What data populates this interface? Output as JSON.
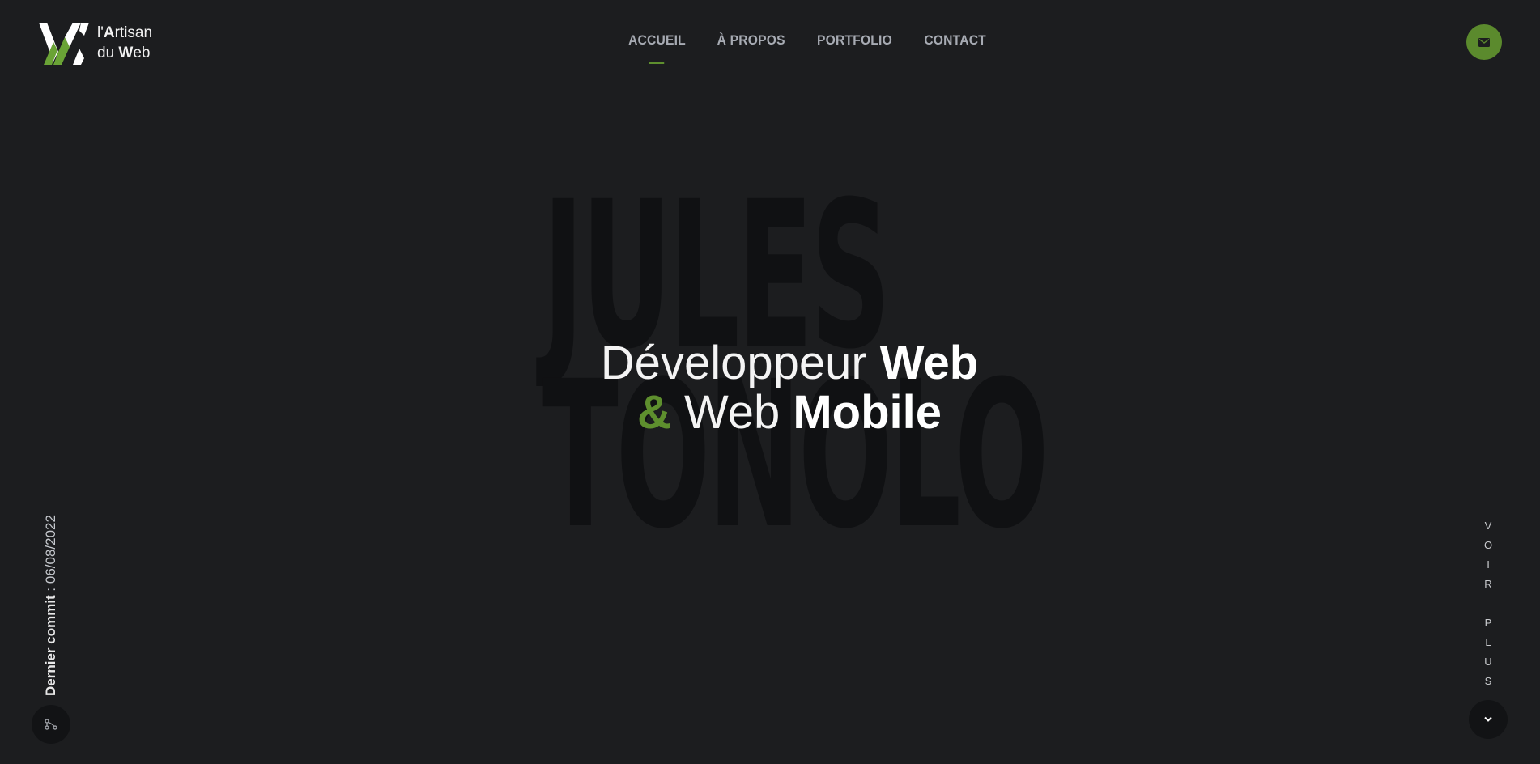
{
  "brand": {
    "line1_prefix": "l'",
    "line1_bold": "A",
    "line1_rest": "rtisan",
    "line2_prefix": "du ",
    "line2_bold": "W",
    "line2_rest": "eb",
    "logo_icon": "aw-logo-icon",
    "accent_color": "#5e8f2e"
  },
  "nav": {
    "items": [
      {
        "label": "ACCUEIL",
        "active": true
      },
      {
        "label": "À PROPOS",
        "active": false
      },
      {
        "label": "PORTFOLIO",
        "active": false
      },
      {
        "label": "CONTACT",
        "active": false
      }
    ]
  },
  "mail_button": {
    "icon": "envelope-icon"
  },
  "background_name": {
    "line1": "JULES",
    "line2": "TONOLO"
  },
  "hero": {
    "line1_light": "Développeur ",
    "line1_bold": "Web",
    "line2_amp": "&",
    "line2_light": " Web ",
    "line2_bold": "Mobile"
  },
  "commit": {
    "label": "Dernier commit",
    "separator": " : ",
    "date": "06/08/2022",
    "icon": "git-commit-icon"
  },
  "scroll": {
    "letters_1": [
      "V",
      "O",
      "I",
      "R"
    ],
    "letters_2": [
      "P",
      "L",
      "U",
      "S"
    ],
    "icon": "chevron-down-icon"
  }
}
